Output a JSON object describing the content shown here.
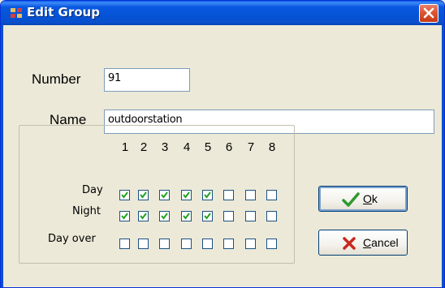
{
  "window": {
    "title": "Edit Group",
    "title_icon": "app-icon",
    "close_icon": "close-icon"
  },
  "form": {
    "number_label": "Number",
    "number_value": "91",
    "name_label": "Name",
    "name_value": "outdoorstation"
  },
  "schedule": {
    "columns": [
      "1",
      "2",
      "3",
      "4",
      "5",
      "6",
      "7",
      "8"
    ],
    "rows": [
      {
        "label": "Day",
        "checked": [
          true,
          true,
          true,
          true,
          true,
          false,
          false,
          false
        ]
      },
      {
        "label": "Night",
        "checked": [
          true,
          true,
          true,
          true,
          true,
          false,
          false,
          false
        ]
      },
      {
        "label": "Day over",
        "checked": [
          false,
          false,
          false,
          false,
          false,
          false,
          false,
          false
        ]
      }
    ]
  },
  "buttons": {
    "ok": {
      "mnemonic": "O",
      "rest": "k",
      "icon": "checkmark-icon",
      "color": "#2e9a2e"
    },
    "cancel": {
      "mnemonic": "C",
      "rest": "ancel",
      "icon": "x-icon",
      "color": "#c8281e"
    }
  }
}
